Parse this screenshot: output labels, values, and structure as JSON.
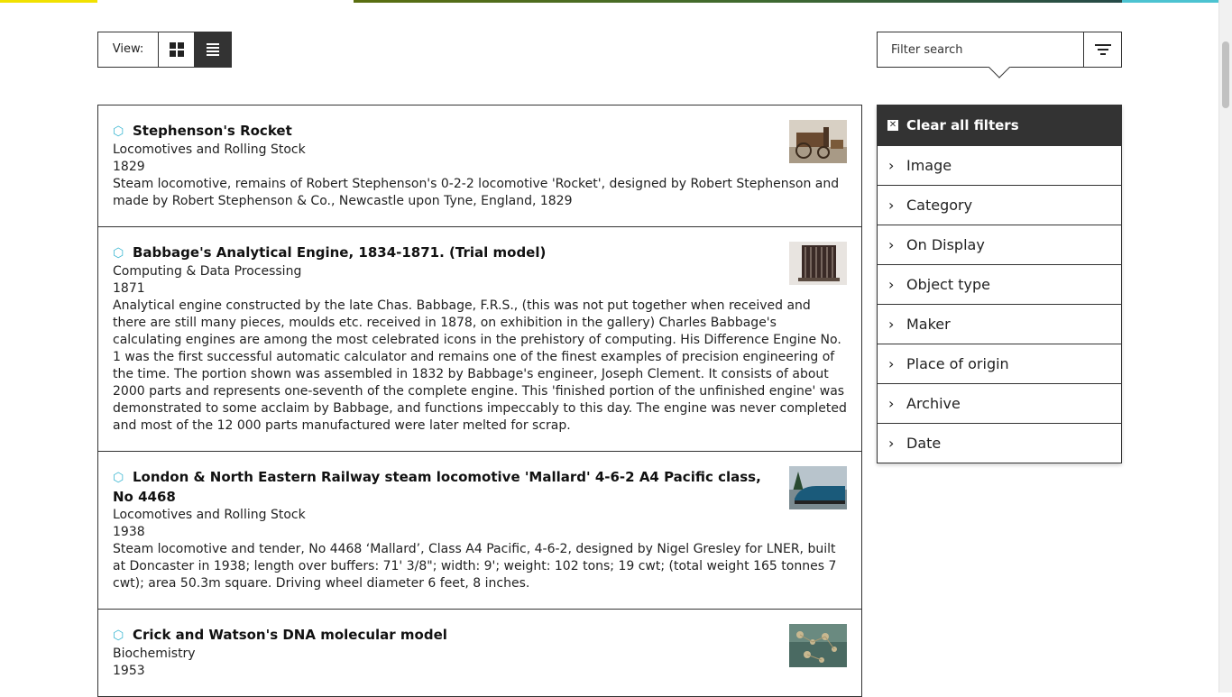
{
  "colors": {
    "topbar": [
      "#f1e100",
      "#ffffff",
      "#5a7a10",
      "#2a4a3a",
      "#4cc3d1"
    ],
    "accent_cube": "#3cb7d2",
    "dark": "#333333"
  },
  "view": {
    "label": "View:",
    "grid_icon": "grid-icon",
    "list_icon": "list-icon",
    "selected": "list"
  },
  "filter_search": {
    "placeholder": "Filter search",
    "value": "",
    "icon": "filter-icon"
  },
  "results": [
    {
      "title": "Stephenson's Rocket",
      "category": "Locomotives and Rolling Stock",
      "date": "1829",
      "description": "Steam locomotive, remains of Robert Stephenson's 0-2-2 locomotive 'Rocket', designed by Robert Stephenson and made by Robert Stephenson & Co., Newcastle upon Tyne, England, 1829",
      "icon": "3d-cube-icon"
    },
    {
      "title": "Babbage's Analytical Engine, 1834-1871. (Trial model)",
      "category": "Computing & Data Processing",
      "date": "1871",
      "description": "Analytical engine constructed by the late Chas. Babbage, F.R.S., (this was not put together when received and there are still many pieces, moulds etc. received in 1878, on exhibition in the gallery) Charles Babbage's calculating engines are among the most celebrated icons in the prehistory of computing. His Difference Engine No. 1 was the first successful automatic calculator and remains one of the finest examples of precision engineering of the time. The portion shown was assembled in 1832 by Babbage's engineer, Joseph Clement. It consists of about 2000 parts and represents one-seventh of the complete engine. This 'finished portion of the unfinished engine' was demonstrated to some acclaim by Babbage, and functions impeccably to this day. The engine was never completed and most of the 12 000 parts manufactured were later melted for scrap.",
      "icon": "3d-cube-icon"
    },
    {
      "title": "London & North Eastern Railway steam locomotive 'Mallard' 4-6-2 A4 Pacific class, No 4468",
      "category": "Locomotives and Rolling Stock",
      "date": "1938",
      "description": "Steam locomotive and tender, No 4468 ‘Mallard’, Class A4 Pacific, 4-6-2, designed by Nigel Gresley for LNER, built at Doncaster in 1938; length over buffers: 71' 3/8\"; width: 9'; weight: 102 tons; 19 cwt; (total weight 165 tonnes 7 cwt); area 50.3m square. Driving wheel diameter 6 feet, 8 inches.",
      "icon": "3d-cube-icon"
    },
    {
      "title": "Crick and Watson's DNA molecular model",
      "category": "Biochemistry",
      "date": "1953",
      "description": "",
      "icon": "3d-cube-icon"
    }
  ],
  "filters": {
    "clear_label": "Clear all filters",
    "items": [
      "Image",
      "Category",
      "On Display",
      "Object type",
      "Maker",
      "Place of origin",
      "Archive",
      "Date"
    ]
  }
}
